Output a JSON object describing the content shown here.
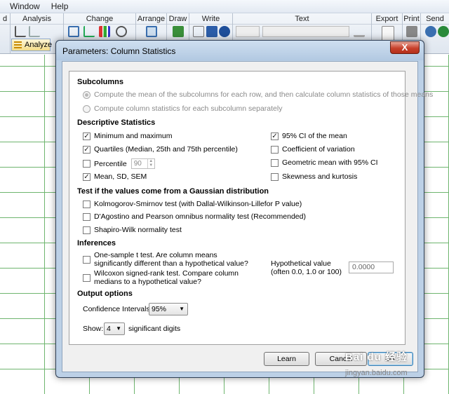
{
  "menu": [
    "Window",
    "Help"
  ],
  "ribbon_groups": [
    "d",
    "Analysis",
    "Change",
    "Arrange",
    "Draw",
    "Write",
    "Text",
    "Export",
    "Print",
    "Send"
  ],
  "analyze_label": "Analyze",
  "dialog": {
    "title": "Parameters: Column Statistics",
    "close_glyph": "X",
    "subcolumns": {
      "heading": "Subcolumns",
      "opt1": "Compute the mean of the subcolumns for each row, and then calculate column statistics of those means",
      "opt2": "Compute column statistics for each subcolumn separately"
    },
    "descriptive": {
      "heading": "Descriptive Statistics",
      "min_max": "Minimum and maximum",
      "quartiles": "Quartiles (Median, 25th and 75th percentile)",
      "percentile": "Percentile",
      "percentile_value": "90",
      "mean_sd": "Mean, SD, SEM",
      "ci_mean": "95% CI of the mean",
      "coef_var": "Coefficient of variation",
      "geo_mean": "Geometric mean with 95% CI",
      "skew": "Skewness and kurtosis"
    },
    "gaussian": {
      "heading": "Test if the values come from a Gaussian distribution",
      "ks": "Kolmogorov-Smirnov test (with Dallal-Wilkinson-Lillefor P value)",
      "dp": "D'Agostino and Pearson omnibus normality test (Recommended)",
      "sw": "Shapiro-Wilk normality test"
    },
    "inferences": {
      "heading": "Inferences",
      "t1": "One-sample t test. Are column means",
      "t2": "significantly different than a hypothetical value?",
      "w1": "Wilcoxon signed-rank test. Compare column",
      "w2": "medians to a hypothetical value?",
      "hyp1": "Hypothetical value",
      "hyp2": "(often 0.0, 1.0 or 100)",
      "hyp_value": "0.0000"
    },
    "output": {
      "heading": "Output options",
      "ci_label": "Confidence Intervals:",
      "ci_value": "95%",
      "show_label": "Show:",
      "show_value": "4",
      "show_suffix": "significant digits"
    },
    "buttons": {
      "learn": "Learn",
      "cancel": "Cancel",
      "ok": "OK"
    }
  },
  "watermark": "Bai du 经验",
  "watermark_url": "jingyan.baidu.com"
}
